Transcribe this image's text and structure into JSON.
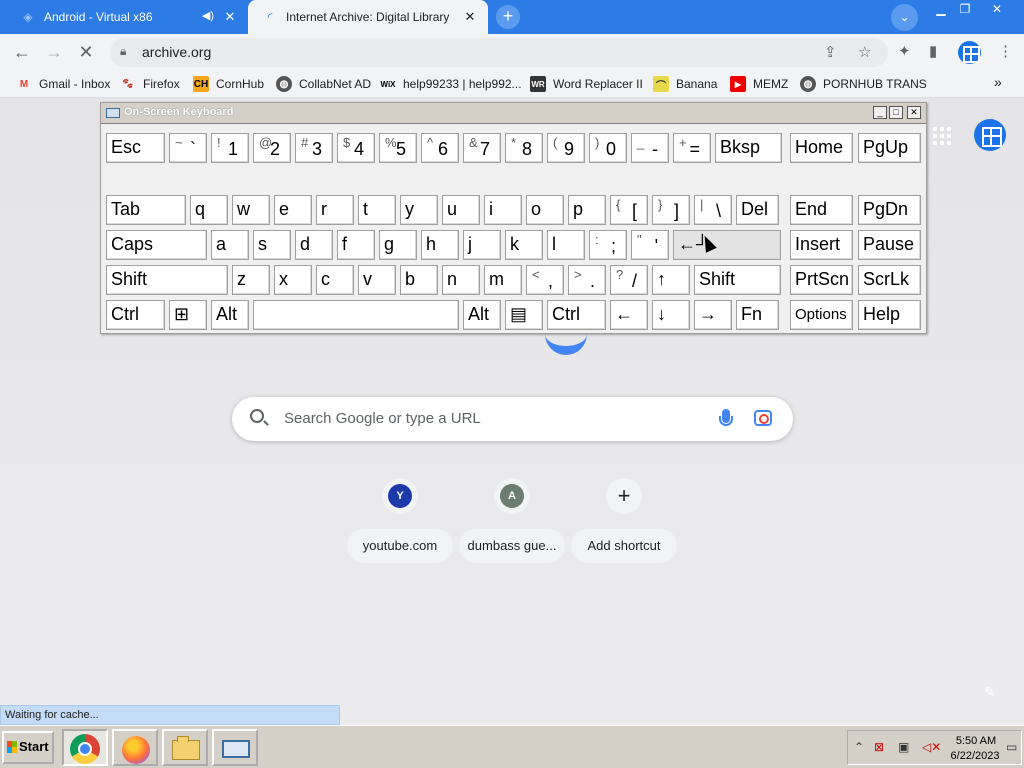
{
  "tabs": [
    {
      "title": "Android - Virtual x86",
      "active": false
    },
    {
      "title": "Internet Archive: Digital Library of Free & Borrowable Books",
      "active": true
    }
  ],
  "toolbar": {
    "url": "archive.org"
  },
  "bookmarks": [
    {
      "label": "Gmail - Inbox",
      "icon": "gmail-icon"
    },
    {
      "label": "Firefox",
      "icon": "firefox-icon"
    },
    {
      "label": "CornHub",
      "icon": "ch-icon"
    },
    {
      "label": "CollabNet AD",
      "icon": "globe-icon"
    },
    {
      "label": "help99233 | help992...",
      "icon": "wix-icon"
    },
    {
      "label": "Word Replacer II",
      "icon": "wr-icon"
    },
    {
      "label": "Banana",
      "icon": "banana-icon"
    },
    {
      "label": "MEMZ",
      "icon": "youtube-icon"
    },
    {
      "label": "PORNHUB TRANS",
      "icon": "globe-icon"
    }
  ],
  "search": {
    "placeholder": "Search Google or type a URL"
  },
  "shortcuts": [
    {
      "label": "youtube.com",
      "letter": "Y",
      "color": "#1c3aa9"
    },
    {
      "label": "dumbass gue...",
      "letter": "A",
      "color": "#6b7d6f"
    },
    {
      "label": "Add shortcut",
      "letter": "+",
      "color": ""
    }
  ],
  "status_text": "Waiting for cache...",
  "osk": {
    "title": "On-Screen Keyboard",
    "row1": [
      {
        "label": "Esc"
      },
      {
        "shift": "~",
        "base": "`"
      },
      {
        "shift": "!",
        "base": "1"
      },
      {
        "shift": "@",
        "base": "2"
      },
      {
        "shift": "#",
        "base": "3"
      },
      {
        "shift": "$",
        "base": "4"
      },
      {
        "shift": "%",
        "base": "5"
      },
      {
        "shift": "^",
        "base": "6"
      },
      {
        "shift": "&",
        "base": "7"
      },
      {
        "shift": "*",
        "base": "8"
      },
      {
        "shift": "(",
        "base": "9"
      },
      {
        "shift": ")",
        "base": "0"
      },
      {
        "shift": "_",
        "base": "-"
      },
      {
        "shift": "+",
        "base": "="
      },
      {
        "label": "Bksp"
      },
      {
        "label": "Home"
      },
      {
        "label": "PgUp"
      }
    ],
    "row2": [
      {
        "label": "Tab"
      },
      {
        "label": "q"
      },
      {
        "label": "w"
      },
      {
        "label": "e"
      },
      {
        "label": "r"
      },
      {
        "label": "t"
      },
      {
        "label": "y"
      },
      {
        "label": "u"
      },
      {
        "label": "i"
      },
      {
        "label": "o"
      },
      {
        "label": "p"
      },
      {
        "shift": "{",
        "base": "["
      },
      {
        "shift": "}",
        "base": "]"
      },
      {
        "shift": "|",
        "base": "\\"
      },
      {
        "label": "Del"
      },
      {
        "label": "End"
      },
      {
        "label": "PgDn"
      }
    ],
    "row3": [
      {
        "label": "Caps"
      },
      {
        "label": "a"
      },
      {
        "label": "s"
      },
      {
        "label": "d"
      },
      {
        "label": "f"
      },
      {
        "label": "g"
      },
      {
        "label": "h"
      },
      {
        "label": "j"
      },
      {
        "label": "k"
      },
      {
        "label": "l"
      },
      {
        "shift": ":",
        "base": ";"
      },
      {
        "shift": "\"",
        "base": "'"
      },
      {
        "label": "←┘"
      },
      {
        "label": "Insert"
      },
      {
        "label": "Pause"
      }
    ],
    "row4": [
      {
        "label": "Shift"
      },
      {
        "label": "z"
      },
      {
        "label": "x"
      },
      {
        "label": "c"
      },
      {
        "label": "v"
      },
      {
        "label": "b"
      },
      {
        "label": "n"
      },
      {
        "label": "m"
      },
      {
        "shift": "<",
        "base": ","
      },
      {
        "shift": ">",
        "base": "."
      },
      {
        "shift": "?",
        "base": "/"
      },
      {
        "label": "↑"
      },
      {
        "label": "Shift"
      },
      {
        "label": "PrtScn"
      },
      {
        "label": "ScrLk"
      }
    ],
    "row5": [
      {
        "label": "Ctrl"
      },
      {
        "label": "⊞"
      },
      {
        "label": "Alt"
      },
      {
        "label": ""
      },
      {
        "label": "Alt"
      },
      {
        "label": "▤"
      },
      {
        "label": "Ctrl"
      },
      {
        "label": "←"
      },
      {
        "label": "↓"
      },
      {
        "label": "→"
      },
      {
        "label": "Fn"
      },
      {
        "label": "Options"
      },
      {
        "label": "Help"
      }
    ]
  },
  "taskbar": {
    "start_label": "Start",
    "clock_time": "5:50 AM",
    "clock_date": "6/22/2023"
  }
}
